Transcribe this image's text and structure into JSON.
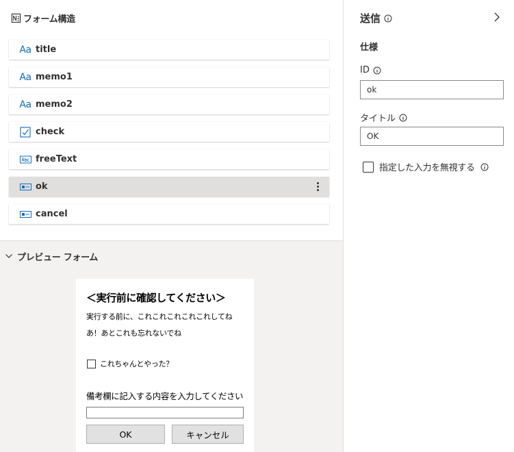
{
  "structure": {
    "title": "フォーム構造",
    "items": [
      {
        "label": "title",
        "icon": "text-icon",
        "selected": false
      },
      {
        "label": "memo1",
        "icon": "text-icon",
        "selected": false
      },
      {
        "label": "memo2",
        "icon": "text-icon",
        "selected": false
      },
      {
        "label": "check",
        "icon": "checkbox-icon",
        "selected": false
      },
      {
        "label": "freeText",
        "icon": "text-input-icon",
        "selected": false
      },
      {
        "label": "ok",
        "icon": "button-icon",
        "selected": true
      },
      {
        "label": "cancel",
        "icon": "button-icon",
        "selected": false
      }
    ],
    "text_icon_glyph": "Aa"
  },
  "preview": {
    "header": "プレビュー フォーム",
    "form": {
      "heading": "＜実行前に確認してください＞",
      "memo1": "実行する前に、これこれこれこれこれしてね",
      "memo2": "あ！あとこれも忘れないでね",
      "check_label": "これちゃんとやった？",
      "free_text_label": "備考欄に記入する内容を入力してください",
      "free_text_value": "",
      "ok_label": "OK",
      "cancel_label": "キャンセル"
    }
  },
  "properties": {
    "title": "送信",
    "section": "仕様",
    "id_label": "ID",
    "id_value": "ok",
    "title_label": "タイトル",
    "title_value": "OK",
    "ignore_input_label": "指定した入力を無視する",
    "ignore_input_checked": false
  },
  "colors": {
    "accent": "#0f6cbd",
    "selected_bg": "#e1dfdd",
    "preview_bg": "#f3f2f1"
  }
}
